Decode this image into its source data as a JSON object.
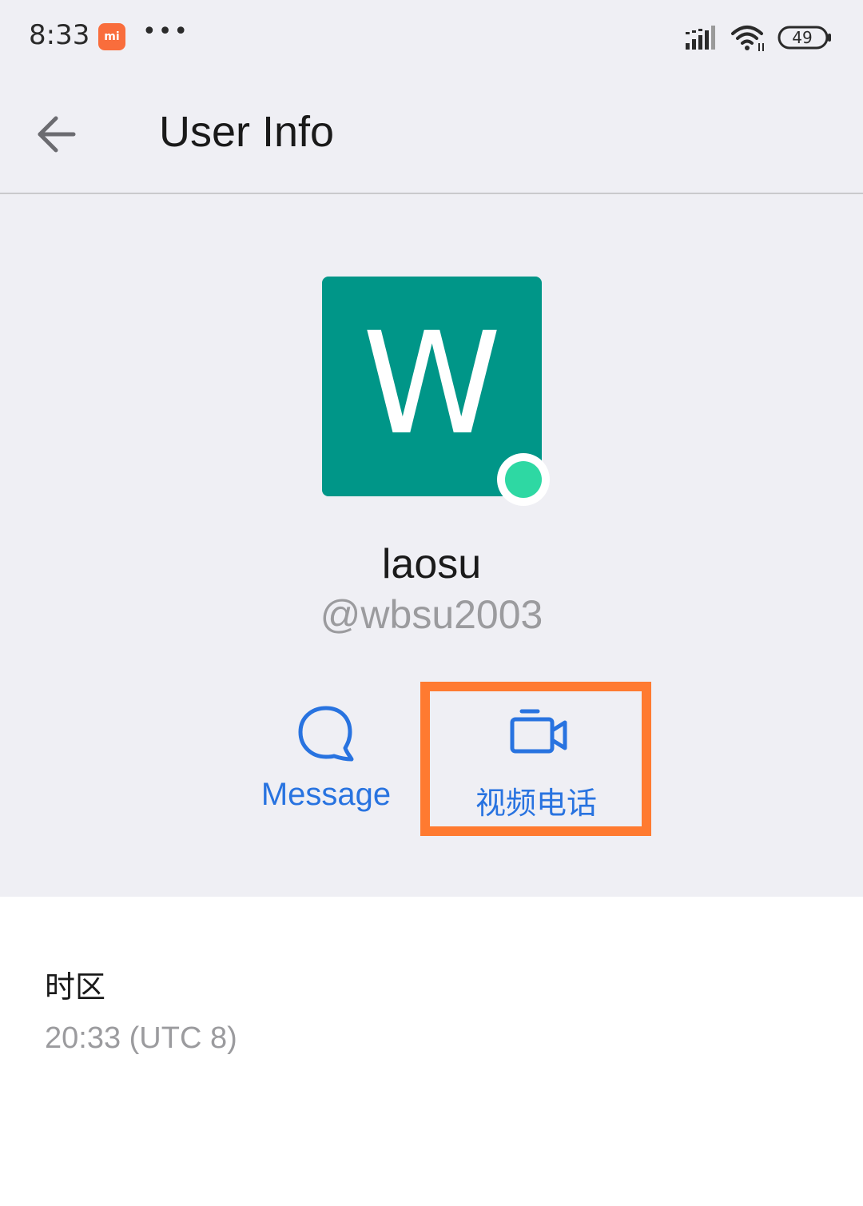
{
  "status_bar": {
    "time": "8:33",
    "mi_badge": "mi",
    "more": "•••",
    "battery": "49",
    "icons": [
      "signal-icon",
      "wifi-icon",
      "battery-icon"
    ]
  },
  "header": {
    "title": "User Info",
    "back_icon": "arrow-left-icon"
  },
  "profile": {
    "avatar_letter": "W",
    "avatar_color": "#009688",
    "online_color": "#2ed8a3",
    "name": "laosu",
    "username": "@wbsu2003"
  },
  "actions": {
    "message_label": "Message",
    "message_icon": "chat-bubble-icon",
    "video_label": "视频电话",
    "video_icon": "video-camera-icon",
    "accent_color": "#2873e0",
    "highlight_color": "#ff7a30"
  },
  "timezone": {
    "label": "时区",
    "value": "20:33 (UTC 8)"
  }
}
